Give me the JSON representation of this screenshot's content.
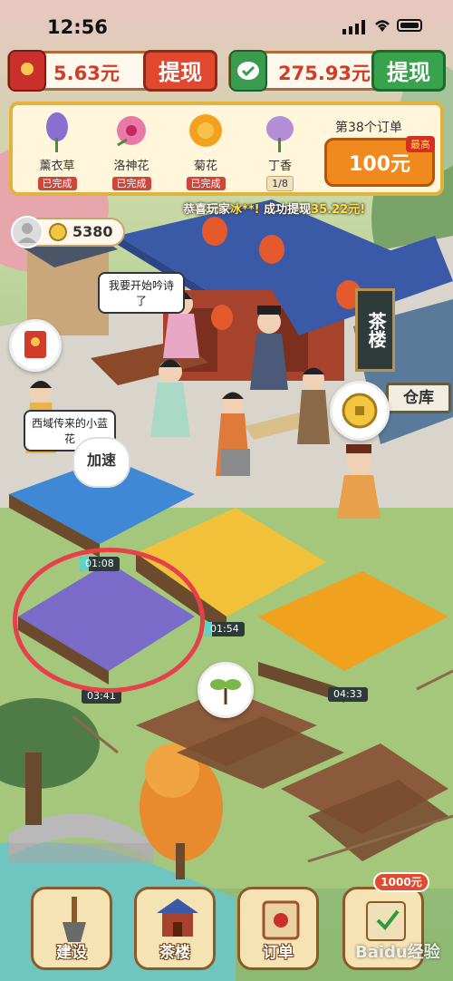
{
  "status_bar": {
    "time": "12:56"
  },
  "currency": {
    "red_packet_value": "5.63元",
    "red_withdraw_label": "提现",
    "wechat_value": "275.93元",
    "wechat_withdraw_label": "提现"
  },
  "orders": {
    "items": [
      {
        "name": "薰衣草",
        "status": "已完成",
        "color": "#8a6fd1"
      },
      {
        "name": "洛神花",
        "status": "已完成",
        "color": "#e97aa6"
      },
      {
        "name": "菊花",
        "status": "已完成",
        "color": "#f2a21e"
      },
      {
        "name": "丁香",
        "status": "1/8",
        "color": "#b48fd8"
      }
    ],
    "order_title": "第38个订单",
    "reward_label": "最高",
    "reward_amount": "100元"
  },
  "ticker": {
    "prefix": "恭喜玩家",
    "player": "冰**!",
    "middle": "成功提现",
    "amount": "35.22元!"
  },
  "player": {
    "coins": "5380"
  },
  "speech": {
    "poet": "我要开始吟诗了",
    "merchant": "西域传来的小蓝花",
    "speed_up": "加速"
  },
  "signs": {
    "teahouse": "茶楼",
    "warehouse": "仓库"
  },
  "timers": {
    "blue_field": "01:08",
    "lavender_field": "03:41",
    "sunflower_field": "01:54",
    "chrysanthemum_field": "04:33"
  },
  "bottom_nav": {
    "build_label": "建设",
    "teahouse_label": "茶楼",
    "order_label": "订单",
    "reward_badge": "1000元"
  },
  "watermark": "Baidu经验",
  "colors": {
    "accent_red": "#e1482f",
    "accent_green": "#37a34c",
    "gold": "#e3b23c"
  }
}
